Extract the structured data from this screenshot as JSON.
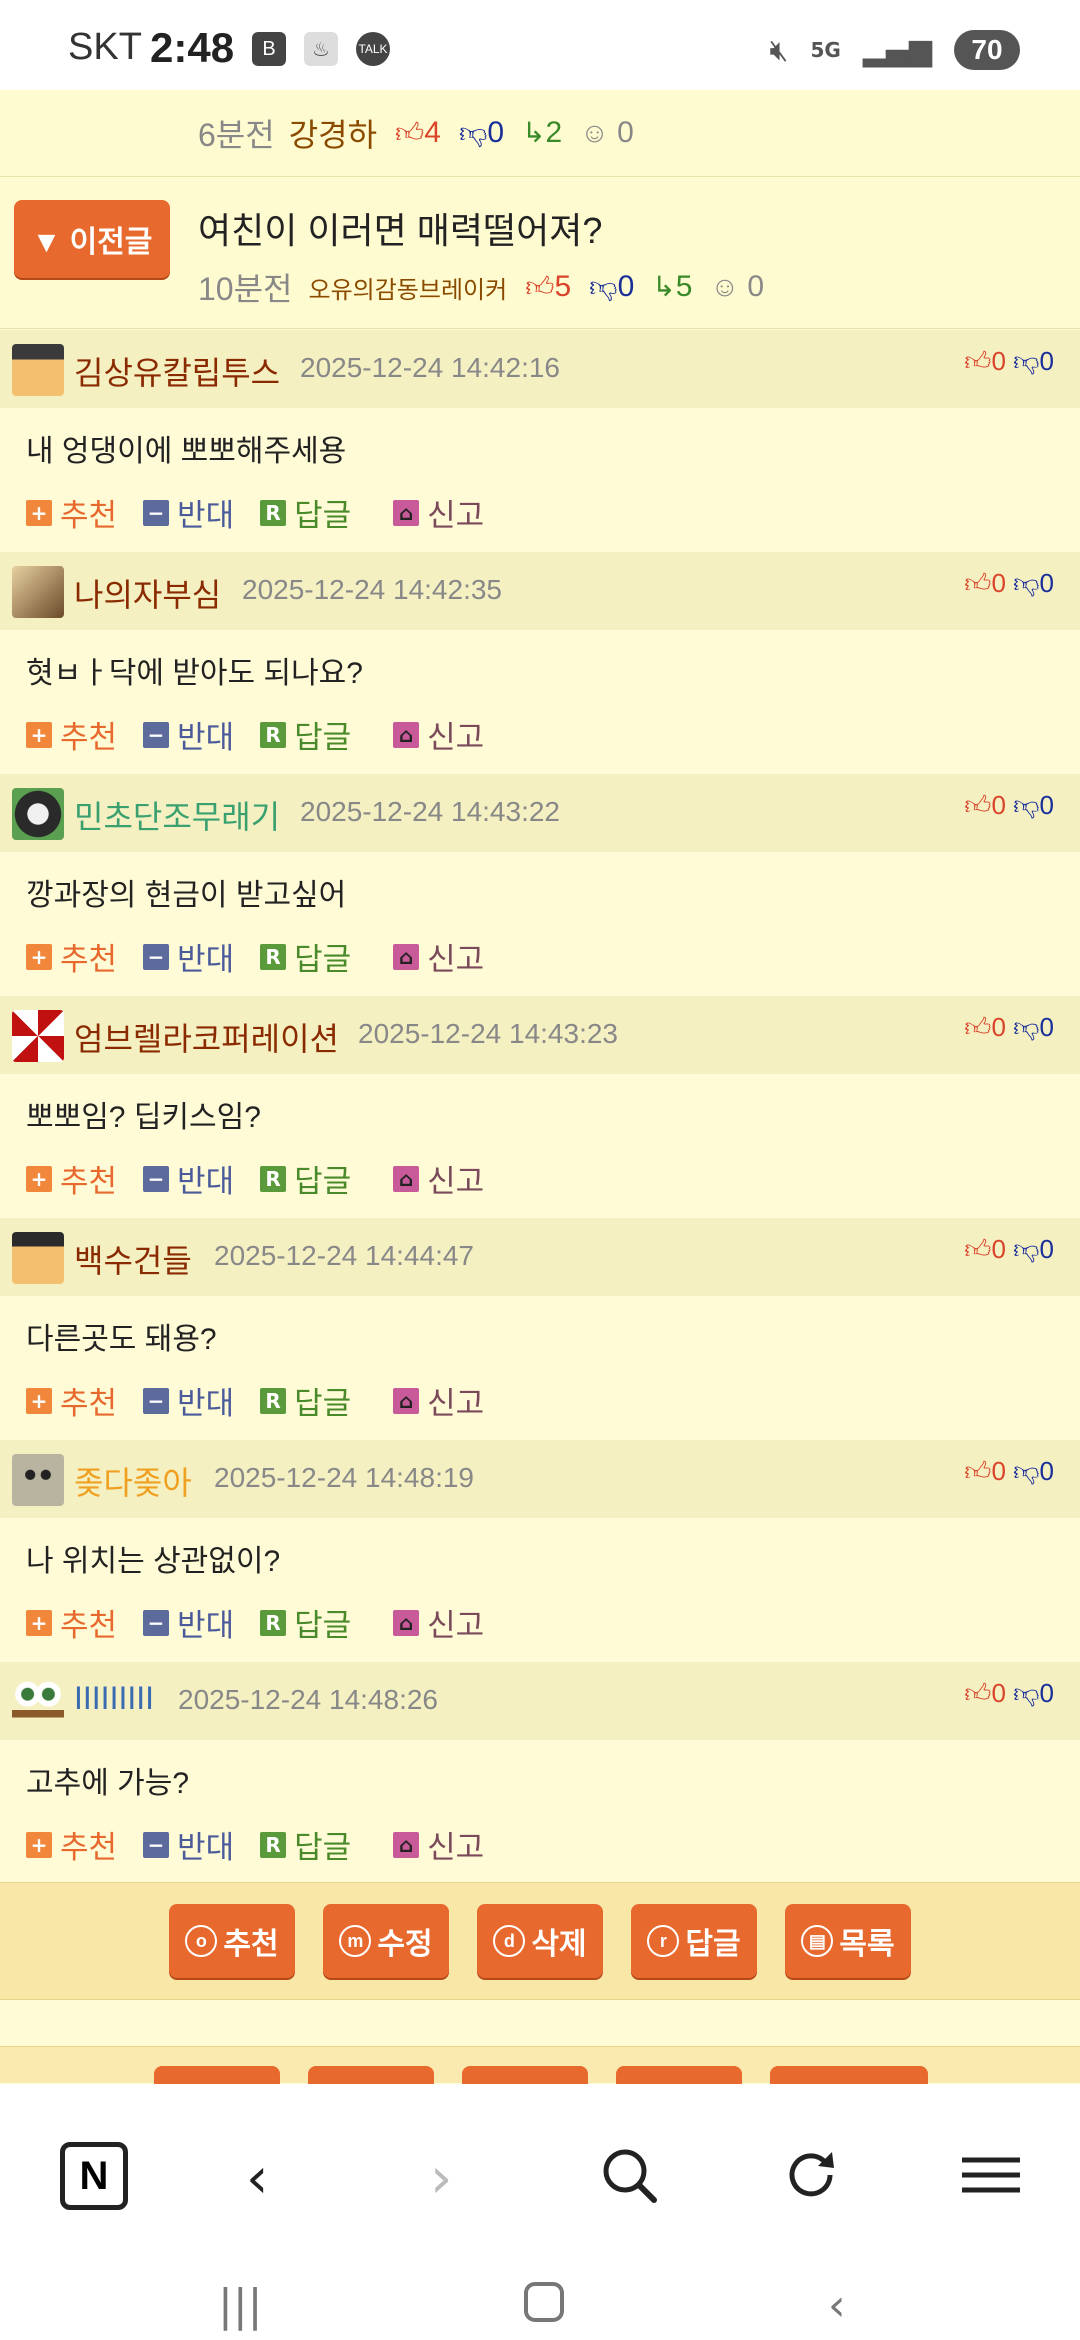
{
  "status_bar": {
    "carrier": "SKT",
    "time": "2:48",
    "icons": [
      "b-app-icon",
      "baby-bottle-icon",
      "kakaotalk-icon"
    ],
    "badge_b": "B",
    "badge_talk": "TALK",
    "network": "5G",
    "battery": "70"
  },
  "prev_post_row": {
    "ago": "6분전",
    "writer": "강경하",
    "likes": "4",
    "dislikes": "0",
    "replies": "2",
    "views": "0"
  },
  "prev_post": {
    "button_label": "▼ 이전글",
    "title": "여친이 이러면 매력떨어져?",
    "ago": "10분전",
    "writer": "오유의감동브레이커",
    "likes": "5",
    "dislikes": "0",
    "replies": "5",
    "views": "0"
  },
  "action_labels": {
    "recommend": "추천",
    "oppose": "반대",
    "reply": "답글",
    "report": "신고"
  },
  "comments": [
    {
      "name": "김상유칼립투스",
      "name_color": "#8a2a00",
      "date": "2025-12-24 14:42:16",
      "up": "0",
      "down": "0",
      "text": "내 엉댕이에 뽀뽀해주세용"
    },
    {
      "name": "나의자부심",
      "name_color": "#8a2a00",
      "date": "2025-12-24 14:42:35",
      "up": "0",
      "down": "0",
      "text": "혓ㅂㅏ닥에 받아도 되나요?"
    },
    {
      "name": "민초단조무래기",
      "name_color": "#3aa070",
      "date": "2025-12-24 14:43:22",
      "up": "0",
      "down": "0",
      "text": "깡과장의 현금이 받고싶어"
    },
    {
      "name": "엄브렐라코퍼레이션",
      "name_color": "#8a2a00",
      "date": "2025-12-24 14:43:23",
      "up": "0",
      "down": "0",
      "text": "뽀뽀임? 딥키스임?"
    },
    {
      "name": "백수건들",
      "name_color": "#8a2a00",
      "date": "2025-12-24 14:44:47",
      "up": "0",
      "down": "0",
      "text": "다른곳도 돼용?"
    },
    {
      "name": "좆다좆아",
      "name_color": "#f0a020",
      "date": "2025-12-24 14:48:19",
      "up": "0",
      "down": "0",
      "text": "나 위치는 상관없이?"
    },
    {
      "name": "IIIIIIIII",
      "name_color": "#3a6ab0",
      "date": "2025-12-24 14:48:26",
      "up": "0",
      "down": "0",
      "text": "고추에 가능?"
    }
  ],
  "bottom_buttons": [
    {
      "icon": "o",
      "label": "추천"
    },
    {
      "icon": "m",
      "label": "수정"
    },
    {
      "icon": "d",
      "label": "삭제"
    },
    {
      "icon": "r",
      "label": "답글"
    },
    {
      "icon": "▤",
      "label": "목록"
    }
  ],
  "browser_nav": {
    "home": "N",
    "back": "‹",
    "forward": "›",
    "search": "search-icon",
    "refresh": "refresh-icon",
    "menu": "menu-icon"
  },
  "system_nav": {
    "recents": "|||",
    "home": "home-icon",
    "back": "‹"
  },
  "colors": {
    "accent": "#e8692e",
    "background": "#fffbd6",
    "comment_header": "#f4f0c2",
    "up_vote": "#d9442a",
    "down_vote": "#1a2f9a"
  }
}
